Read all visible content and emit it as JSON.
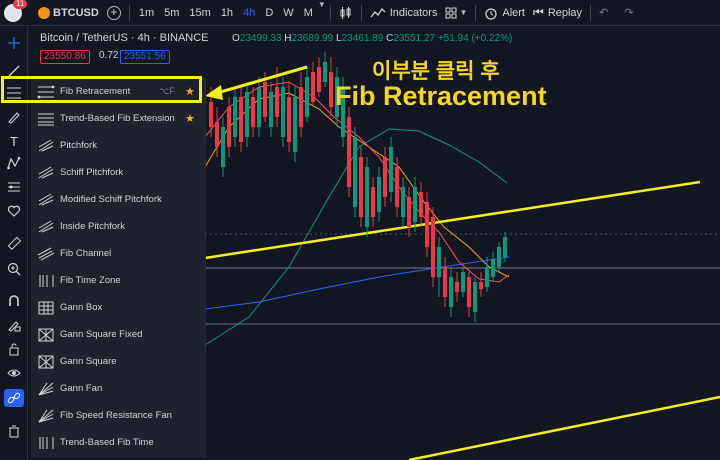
{
  "toolbar": {
    "notification_count": "11",
    "symbol": "BTCUSD",
    "timeframes": [
      "1m",
      "5m",
      "15m",
      "1h",
      "4h",
      "D",
      "W",
      "M"
    ],
    "active_timeframe": "4h",
    "indicators_label": "Indicators",
    "alert_label": "Alert",
    "replay_label": "Replay"
  },
  "legend": {
    "title": "Bitcoin / TetherUS · 4h · BINANCE",
    "o_label": "O",
    "o_value": "23499.33",
    "h_label": "H",
    "h_value": "23689.99",
    "l_label": "L",
    "l_value": "23461.89",
    "c_label": "C",
    "c_value": "23551.27",
    "change": "+51.94 (+0.22%)",
    "sell_price": "23550.86",
    "spread": "0.72",
    "buy_price": "23551.56"
  },
  "menu": {
    "items": [
      {
        "label": "Fib Retracement",
        "shortcut": "⌥F",
        "starred": "★",
        "icon": "fib-retracement-icon"
      },
      {
        "label": "Trend-Based Fib Extension",
        "shortcut": "",
        "starred": "★",
        "icon": "trend-fib-extension-icon"
      },
      {
        "label": "Pitchfork",
        "shortcut": "",
        "starred": "",
        "icon": "pitchfork-icon"
      },
      {
        "label": "Schiff Pitchfork",
        "shortcut": "",
        "starred": "",
        "icon": "schiff-pitchfork-icon"
      },
      {
        "label": "Modified Schiff Pitchfork",
        "shortcut": "",
        "starred": "",
        "icon": "modified-schiff-pitchfork-icon"
      },
      {
        "label": "Inside Pitchfork",
        "shortcut": "",
        "starred": "",
        "icon": "inside-pitchfork-icon"
      },
      {
        "label": "Fib Channel",
        "shortcut": "",
        "starred": "",
        "icon": "fib-channel-icon"
      },
      {
        "label": "Fib Time Zone",
        "shortcut": "",
        "starred": "",
        "icon": "fib-time-zone-icon"
      },
      {
        "label": "Gann Box",
        "shortcut": "",
        "starred": "",
        "icon": "gann-box-icon"
      },
      {
        "label": "Gann Square Fixed",
        "shortcut": "",
        "starred": "",
        "icon": "gann-square-fixed-icon"
      },
      {
        "label": "Gann Square",
        "shortcut": "",
        "starred": "",
        "icon": "gann-square-icon"
      },
      {
        "label": "Gann Fan",
        "shortcut": "",
        "starred": "",
        "icon": "gann-fan-icon"
      },
      {
        "label": "Fib Speed Resistance Fan",
        "shortcut": "",
        "starred": "",
        "icon": "fib-speed-resistance-fan-icon"
      },
      {
        "label": "Trend-Based Fib Time",
        "shortcut": "",
        "starred": "",
        "icon": "trend-fib-time-icon"
      }
    ]
  },
  "annotation": {
    "line1": "이부분 클릭 후",
    "line2": "Fib Retracement"
  },
  "colors": {
    "background": "#131722",
    "menu_background": "#1e222d",
    "up": "#089981",
    "down": "#f23645",
    "accent": "#2962ff",
    "highlight": "#f2ef20",
    "annotation": "#f6d52a"
  }
}
